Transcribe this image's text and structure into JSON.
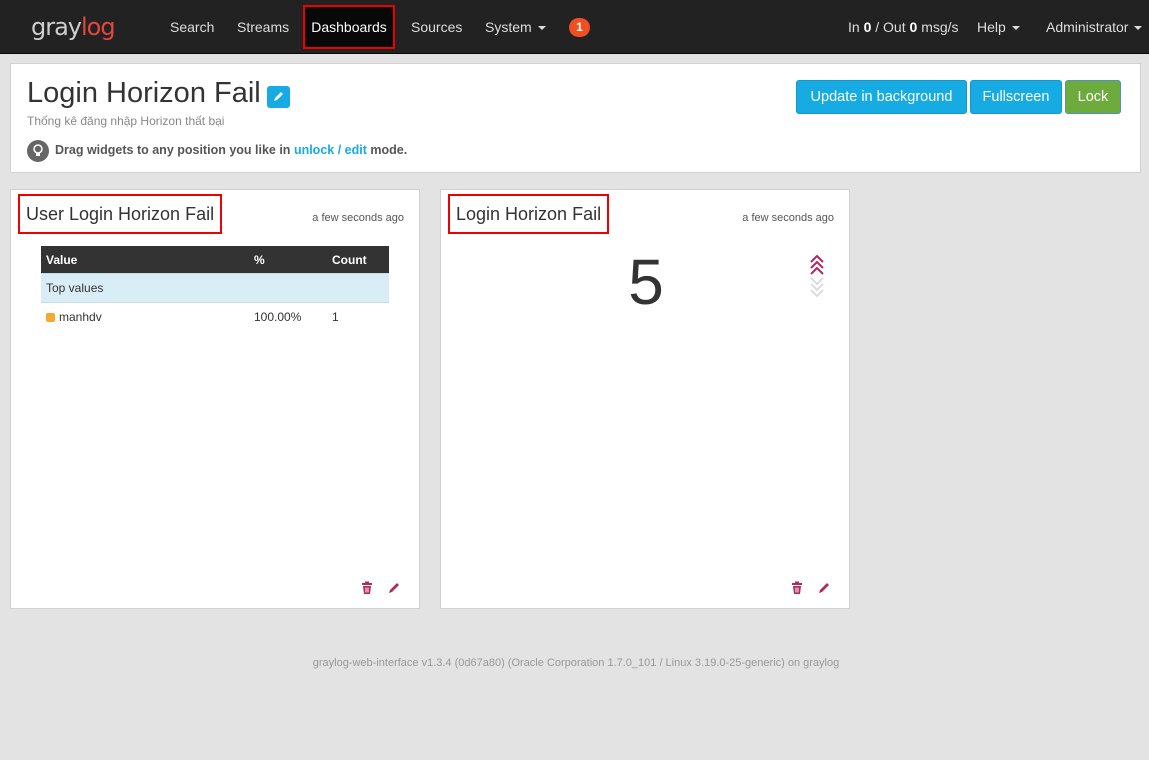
{
  "brand": {
    "part1": "gray",
    "part2": "log"
  },
  "nav": {
    "search": "Search",
    "streams": "Streams",
    "dashboards": "Dashboards",
    "sources": "Sources",
    "system": "System",
    "notification_count": "1",
    "throughput": {
      "in_label": "In",
      "in_value": "0",
      "out_label": "Out",
      "out_value": "0",
      "unit": "msg/s"
    },
    "help": "Help",
    "user": "Administrator"
  },
  "dashboard": {
    "title": "Login Horizon Fail",
    "description": "Thống kê đăng nhập Horizon thất bại",
    "hint_prefix": "Drag widgets to any position you like in",
    "hint_link": "unlock / edit",
    "hint_suffix": "mode.",
    "buttons": {
      "update": "Update in background",
      "fullscreen": "Fullscreen",
      "lock": "Lock"
    }
  },
  "widgets": [
    {
      "title": "User Login Horizon Fail",
      "updated": "a few seconds ago",
      "table": {
        "headers": [
          "Value",
          "%",
          "Count"
        ],
        "group_label": "Top values",
        "rows": [
          {
            "value": "manhdv",
            "percent": "100.00%",
            "count": "1",
            "color": "#f5a832"
          }
        ]
      }
    },
    {
      "title": "Login Horizon Fail",
      "updated": "a few seconds ago",
      "value": "5",
      "trend": "up"
    }
  ],
  "colors": {
    "accent": "#16ace3",
    "success": "#6dab3c",
    "brand_red": "#e0473d",
    "highlight": "#ee0000"
  },
  "footer": "graylog-web-interface v1.3.4 (0d67a80) (Oracle Corporation 1.7.0_101 / Linux 3.19.0-25-generic) on graylog"
}
